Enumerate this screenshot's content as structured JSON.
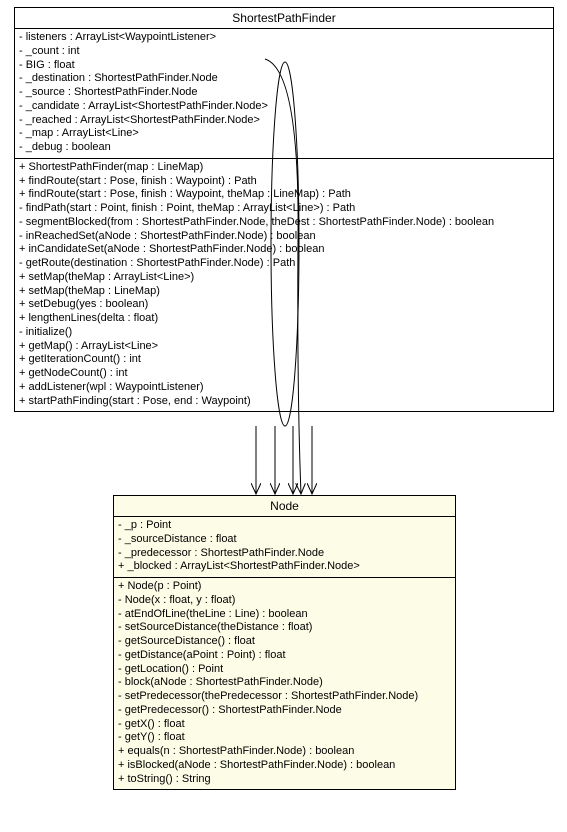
{
  "classes": {
    "spf": {
      "name": "ShortestPathFinder",
      "attributes": [
        "- listeners : ArrayList<WaypointListener>",
        "- _count : int",
        "- BIG : float",
        "- _destination : ShortestPathFinder.Node",
        "- _source : ShortestPathFinder.Node",
        "- _candidate : ArrayList<ShortestPathFinder.Node>",
        "- _reached : ArrayList<ShortestPathFinder.Node>",
        "- _map : ArrayList<Line>",
        "- _debug : boolean"
      ],
      "operations": [
        "+ ShortestPathFinder(map : LineMap)",
        "+ findRoute(start : Pose, finish : Waypoint) : Path",
        "+ findRoute(start : Pose, finish : Waypoint, theMap : LineMap) : Path",
        "- findPath(start : Point, finish : Point, theMap : ArrayList<Line>) : Path",
        "- segmentBlocked(from : ShortestPathFinder.Node, theDest : ShortestPathFinder.Node) : boolean",
        "- inReachedSet(aNode : ShortestPathFinder.Node) : boolean",
        "+ inCandidateSet(aNode : ShortestPathFinder.Node) : boolean",
        "- getRoute(destination : ShortestPathFinder.Node) : Path",
        "+ setMap(theMap : ArrayList<Line>)",
        "+ setMap(theMap : LineMap)",
        "+ setDebug(yes : boolean)",
        "+ lengthenLines(delta : float)",
        "- initialize()",
        "+ getMap() : ArrayList<Line>",
        "+ getIterationCount() : int",
        "+ getNodeCount() : int",
        "+ addListener(wpl : WaypointListener)",
        "+ startPathFinding(start : Pose, end : Waypoint)"
      ]
    },
    "node": {
      "name": "Node",
      "attributes": [
        "- _p : Point",
        "- _sourceDistance : float",
        "- _predecessor : ShortestPathFinder.Node",
        "+ _blocked : ArrayList<ShortestPathFinder.Node>"
      ],
      "operations": [
        "+ Node(p : Point)",
        "- Node(x : float, y : float)",
        "- atEndOfLine(theLine : Line) : boolean",
        "- setSourceDistance(theDistance : float)",
        "- getSourceDistance() : float",
        "- getDistance(aPoint : Point) : float",
        "- getLocation() : Point",
        "- block(aNode : ShortestPathFinder.Node)",
        "- setPredecessor(thePredecessor : ShortestPathFinder.Node)",
        "- getPredecessor() : ShortestPathFinder.Node",
        "- getX() : float",
        "- getY() : float",
        "+ equals(n : ShortestPathFinder.Node) : boolean",
        "+ isBlocked(aNode : ShortestPathFinder.Node) : boolean",
        "+ toString() : String"
      ]
    }
  }
}
